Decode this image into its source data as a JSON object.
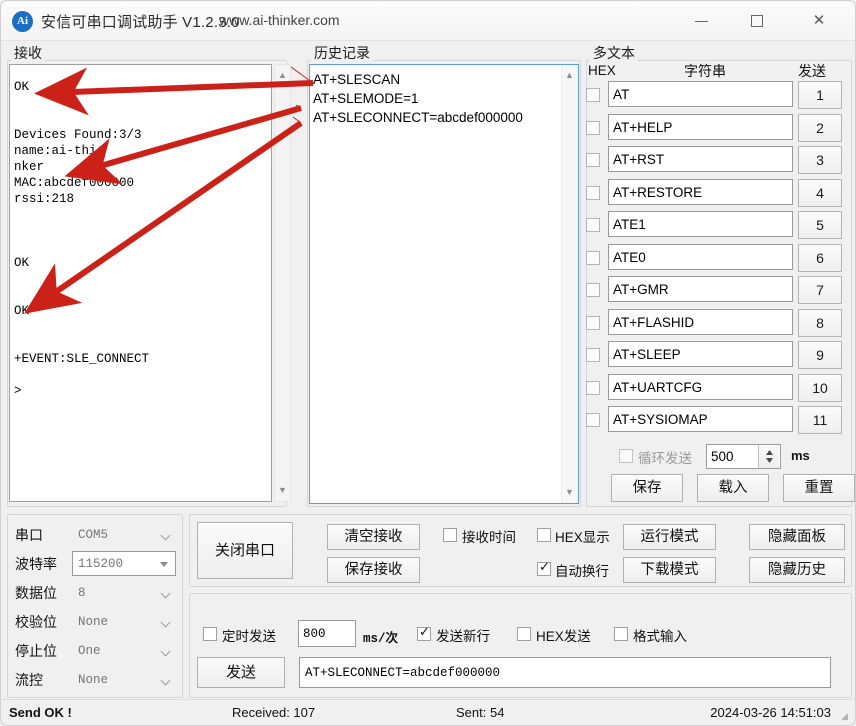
{
  "window": {
    "icon_text": "Ai",
    "title": "安信可串口调试助手 V1.2.3.0",
    "url": "www.ai-thinker.com",
    "minimize_label": "",
    "maximize_label": "",
    "close_label": "✕"
  },
  "receive": {
    "group_label": "接收",
    "content": "OK\n\n\nDevices Found:3/3\nname:ai-thi\nnker\nMAC:abcdef000000\nrssi:218\n\n\n\nOK\n\n\nOK\n\n\n+EVENT:SLE_CONNECT\n\n>",
    "scroll_up_icon": "▲",
    "scroll_down_icon": "▼"
  },
  "history": {
    "group_label": "历史记录",
    "items": [
      "AT+SLESCAN",
      "AT+SLEMODE=1",
      "AT+SLECONNECT=abcdef000000"
    ],
    "scroll_up_icon": "▲",
    "scroll_down_icon": "▼"
  },
  "multitext": {
    "group_label": "多文本",
    "header_hex": "HEX",
    "header_string": "字符串",
    "header_send": "发送",
    "rows": [
      {
        "hex_checked": false,
        "value": "AT",
        "send_label": "1"
      },
      {
        "hex_checked": false,
        "value": "AT+HELP",
        "send_label": "2"
      },
      {
        "hex_checked": false,
        "value": "AT+RST",
        "send_label": "3"
      },
      {
        "hex_checked": false,
        "value": "AT+RESTORE",
        "send_label": "4"
      },
      {
        "hex_checked": false,
        "value": "ATE1",
        "send_label": "5"
      },
      {
        "hex_checked": false,
        "value": "ATE0",
        "send_label": "6"
      },
      {
        "hex_checked": false,
        "value": "AT+GMR",
        "send_label": "7"
      },
      {
        "hex_checked": false,
        "value": "AT+FLASHID",
        "send_label": "8"
      },
      {
        "hex_checked": false,
        "value": "AT+SLEEP",
        "send_label": "9"
      },
      {
        "hex_checked": false,
        "value": "AT+UARTCFG",
        "send_label": "10"
      },
      {
        "hex_checked": false,
        "value": "AT+SYSIOMAP",
        "send_label": "11"
      }
    ],
    "loop_send_label": "循环发送",
    "loop_send_checked": false,
    "loop_interval": "500",
    "loop_unit": "ms",
    "save_label": "保存",
    "load_label": "载入",
    "reset_label": "重置"
  },
  "serial": {
    "rows": [
      {
        "label": "串口",
        "value": "COM5",
        "focused": false
      },
      {
        "label": "波特率",
        "value": "115200",
        "focused": true
      },
      {
        "label": "数据位",
        "value": "8",
        "focused": false
      },
      {
        "label": "校验位",
        "value": "None",
        "focused": false
      },
      {
        "label": "停止位",
        "value": "One",
        "focused": false
      },
      {
        "label": "流控",
        "value": "None",
        "focused": false
      }
    ]
  },
  "controls": {
    "close_port_label": "关闭串口",
    "clear_recv_label": "清空接收",
    "save_recv_label": "保存接收",
    "recv_time_label": "接收时间",
    "recv_time_checked": false,
    "hex_display_label": "HEX显示",
    "hex_display_checked": false,
    "auto_wrap_label": "自动换行",
    "auto_wrap_checked": true,
    "run_mode_label": "运行模式",
    "download_mode_label": "下载模式",
    "hide_panel_label": "隐藏面板",
    "hide_history_label": "隐藏历史"
  },
  "sendbar": {
    "timed_send_label": "定时发送",
    "timed_send_checked": false,
    "timed_interval": "800",
    "ms_per_time_label": "ms/次",
    "send_newline_label": "发送新行",
    "send_newline_checked": true,
    "hex_send_label": "HEX发送",
    "hex_send_checked": false,
    "format_input_label": "格式输入",
    "format_input_checked": false,
    "send_button_label": "发送",
    "send_value": "AT+SLECONNECT=abcdef000000"
  },
  "status": {
    "message": "Send OK !",
    "received": "Received: 107",
    "sent": "Sent: 54",
    "datetime": "2024-03-26 14:51:03"
  },
  "colors": {
    "accent": "#1a6fc4",
    "annotation": "#cc2119",
    "focus_border": "#5d9cd8"
  }
}
